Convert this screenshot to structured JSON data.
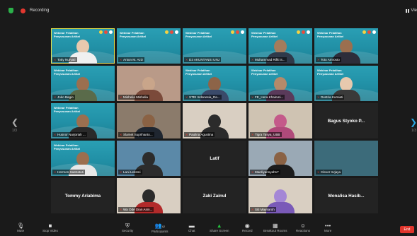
{
  "topbar": {
    "recording_label": "Recording",
    "view_label": "Vie"
  },
  "nav": {
    "left_arrow": "❮",
    "right_arrow": "❯",
    "left_page": "1/3",
    "right_page": "1/3"
  },
  "slide_text": "Webinar Pelatihan Penyusunan Artikel",
  "tiles": [
    {
      "name": "Totty Nuryati",
      "kind": "slide-person",
      "highlight": true
    },
    {
      "name": "Anton M. Aziz",
      "kind": "slide"
    },
    {
      "name": "D3 AKUNTANSI UNJ",
      "kind": "slide"
    },
    {
      "name": "Muhammad Rifki S...",
      "kind": "slide-person"
    },
    {
      "name": "Toto Amrosto",
      "kind": "slide-person"
    },
    {
      "name": "Joko Bagio",
      "kind": "slide-person"
    },
    {
      "name": "Mishelia Mishelia",
      "kind": "photo"
    },
    {
      "name": "STEI Indonesia_Da...",
      "kind": "slide-person"
    },
    {
      "name": "FE_Hera Khairuni...",
      "kind": "slide-person"
    },
    {
      "name": "Destria Kurniati",
      "kind": "slide-person"
    },
    {
      "name": "Husnor Nurjoriah ...",
      "kind": "slide-person"
    },
    {
      "name": "Slamet Suprihanto...",
      "kind": "photo"
    },
    {
      "name": "Paulina Agustina",
      "kind": "photo"
    },
    {
      "name": "Tigra Tasya_UBB",
      "kind": "photo"
    },
    {
      "name": "Bagus Styoko P...",
      "kind": "name-only"
    },
    {
      "name": "Hermen Sastratuti",
      "kind": "slide-person"
    },
    {
      "name": "Lani Leksmi",
      "kind": "photo"
    },
    {
      "name": "Latif",
      "kind": "name-only"
    },
    {
      "name": "Mardiyansyah17",
      "kind": "photo"
    },
    {
      "name": "Clever Irvjaya",
      "kind": "photo"
    },
    {
      "name": "Tommy Ariabima",
      "kind": "name-only"
    },
    {
      "name": "Wa Ode Dian Asm...",
      "kind": "photo"
    },
    {
      "name": "Zaki Zainul",
      "kind": "name-only"
    },
    {
      "name": "Siti Maysaroh",
      "kind": "photo"
    },
    {
      "name": "Monalisa Hasib...",
      "kind": "name-only"
    }
  ],
  "toolbar": {
    "mute": "Mute",
    "video": "Stop Video",
    "security": "Security",
    "participants": "Participants",
    "participants_count": "42",
    "chat": "Chat",
    "share": "Share Screen",
    "record": "Record",
    "breakout": "Breakout Rooms",
    "reactions": "Reactions",
    "more": "More",
    "end": "End"
  },
  "colors": {
    "slide_teal": "#2190a6",
    "end_red": "#e0352c",
    "share_green": "#25c13e",
    "highlight": "#e6e24a"
  }
}
